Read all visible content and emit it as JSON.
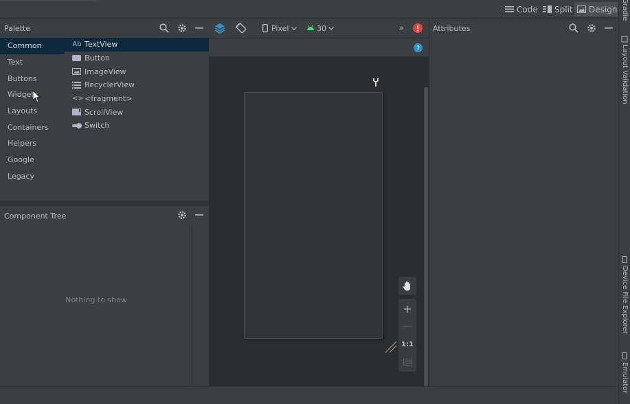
{
  "view_modes": {
    "code": "Code",
    "split": "Split",
    "design": "Design"
  },
  "right_strip": {
    "gradle": "Gradle",
    "layout_validation": "Layout Validation",
    "device_file_explorer": "Device File Explorer",
    "emulator": "Emulator"
  },
  "palette": {
    "title": "Palette",
    "categories": [
      "Common",
      "Text",
      "Buttons",
      "Widgets",
      "Layouts",
      "Containers",
      "Helpers",
      "Google",
      "Legacy"
    ],
    "selected_category": "Common",
    "items": [
      {
        "icon": "textview-icon",
        "glyph": "Ab",
        "label": "TextView"
      },
      {
        "icon": "button-icon",
        "glyph": "",
        "label": "Button"
      },
      {
        "icon": "imageview-icon",
        "glyph": "",
        "label": "ImageView"
      },
      {
        "icon": "recyclerview-icon",
        "glyph": "",
        "label": "RecyclerView"
      },
      {
        "icon": "fragment-icon",
        "glyph": "<>",
        "label": "<fragment>"
      },
      {
        "icon": "scrollview-icon",
        "glyph": "",
        "label": "ScrollView"
      },
      {
        "icon": "switch-icon",
        "glyph": "",
        "label": "Switch"
      }
    ]
  },
  "component_tree": {
    "title": "Component Tree",
    "empty_text": "Nothing to show"
  },
  "design_toolbar": {
    "device": "Pixel",
    "api_level": "30"
  },
  "zoom": {
    "actual_size": "1:1"
  },
  "attributes": {
    "title": "Attributes"
  },
  "colors": {
    "accent_blue": "#3592c4",
    "error_red": "#e0443e",
    "android_green": "#3ddc84",
    "selection": "#0d293e"
  }
}
